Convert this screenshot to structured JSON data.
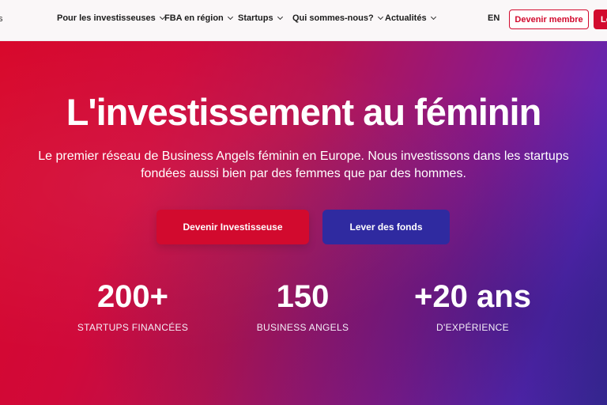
{
  "nav": {
    "items": [
      {
        "label": "Pour les investisseuses"
      },
      {
        "label": "FBA en région"
      },
      {
        "label": "Startups"
      },
      {
        "label": "Qui sommes-nous?"
      },
      {
        "label": "Actualités"
      }
    ],
    "lang": "EN",
    "member_button": "Devenir membre",
    "login_button": "Login"
  },
  "hero": {
    "title": "L'investissement au féminin",
    "subtitle": "Le premier réseau de Business Angels féminin en Europe. Nous investissons dans les startups fondées aussi bien par des femmes que par des hommes.",
    "cta_primary": "Devenir Investisseuse",
    "cta_secondary": "Lever des fonds",
    "stats": [
      {
        "value": "200+",
        "label": "STARTUPS FINANCÉES"
      },
      {
        "value": "150",
        "label": "BUSINESS ANGELS"
      },
      {
        "value": "+20 ans",
        "label": "D'EXPÉRIENCE"
      }
    ]
  },
  "colors": {
    "brand_red": "#d20a2e",
    "secondary_blue": "#2f2aa0"
  }
}
